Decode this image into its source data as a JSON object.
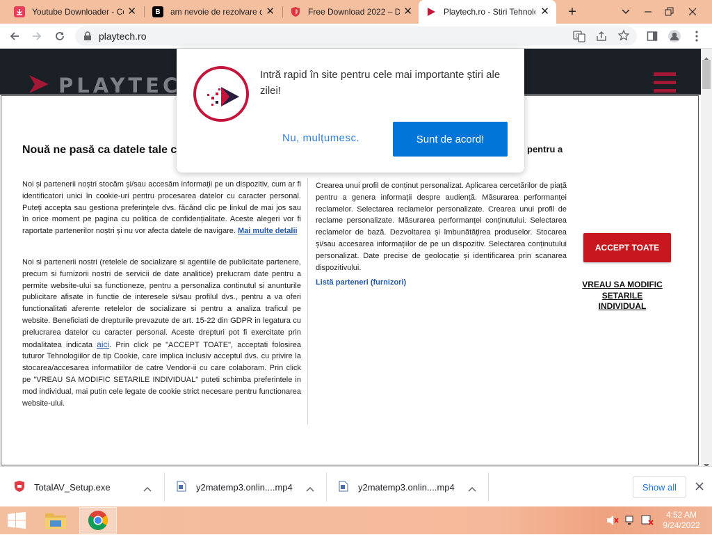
{
  "tabs": [
    {
      "label": "Youtube Downloader - Co",
      "icon": "download-icon",
      "color": "#e83e5c"
    },
    {
      "label": "am nevoie de rezolvare de",
      "icon": "brainly-icon",
      "color": "#000000"
    },
    {
      "label": "Free Download 2022 – D",
      "icon": "shield-icon",
      "color": "#e2323d"
    },
    {
      "label": "Playtech.ro - Stiri Tehnolo",
      "icon": "playtech-icon",
      "color": "#c4163a"
    }
  ],
  "address": {
    "url": "playtech.ro"
  },
  "site": {
    "logo": "PLAYTECH"
  },
  "consent": {
    "title": "Nouă ne pasă ca datele tale confidențiale",
    "right_heading": "pentru a",
    "para1": "Noi și partenerii noștri stocăm și/sau accesăm informații pe un dispozitiv, cum ar fi identificatori unici în cookie-uri pentru procesarea datelor cu caracter personal. Puteți accepta sau gestiona preferințele dvs. făcând clic pe linkul de mai jos sau în orice moment pe pagina cu politica de confidențialitate. Aceste alegeri vor fi raportate partenerilor noștri și nu vor afecta datele de navigare.",
    "more_details": "Mai multe detalii",
    "para2a": "Noi si partenerii nostri (retelele de socializare si agentiile de publicitate partenere, precum si furnizorii nostri de servicii de date analitice) prelucram date pentru a permite website-ului sa functioneze, pentru a personaliza continutul si anunturile publicitare afisate in functie de interesele si/sau profilul dvs., pentru a va oferi functionalitati aferente retelelor de socializare si pentru a analiza traficul pe website. Beneficiati de drepturile prevazute de art. 15-22 din GDPR in legatura cu prelucrarea datelor cu caracter personal. Aceste drepturi pot fi exercitate prin modalitatea indicata",
    "aici": "aici",
    "para2b": ". Prin click pe \"ACCEPT TOATE\", acceptati folosirea tuturor Tehnologiilor de tip Cookie, care implica inclusiv acceptul dvs. cu privire la stocarea/accesarea informatiilor de catre Vendor-ii cu care colaboram. Prin click pe \"VREAU SA MODIFIC SETARILE INDIVIDUAL\" puteti schimba preferintele in mod individual, mai putin cele legate de cookie strict necesare pentru functionarea website-ului.",
    "purposes": "Crearea unui profil de conținut personalizat. Aplicarea cercetărilor de piață pentru a genera informații despre audiență. Măsurarea performanței reclamelor. Selectarea reclamelor personalizate. Crearea unui profil de reclame personalizate. Măsurarea performanței conținutului. Selectarea reclamelor de bază. Dezvoltarea și îmbunătățirea produselor. Stocarea și/sau accesarea informațiilor de pe un dispozitiv. Selectarea conținutului personalizat. Date precise de geolocație și identificarea prin scanarea dispozitivului.",
    "partners_link": "Listă parteneri (furnizori)",
    "accept_all": "ACCEPT TOATE",
    "modify_settings": "VREAU SA MODIFIC SETARILE INDIVIDUAL",
    "accent": "#c8171e"
  },
  "notification": {
    "message": "Intră rapid în site pentru cele mai importante știri ale zilei!",
    "decline": "Nu, mulțumesc.",
    "accept": "Sunt de acord!",
    "accent": "#0275d8"
  },
  "downloads": {
    "items": [
      {
        "name": "TotalAV_Setup.exe",
        "icon": "totalav-icon"
      },
      {
        "name": "y2matemp3.onlin....mp4",
        "icon": "file-icon"
      },
      {
        "name": "y2matemp3.onlin....mp4",
        "icon": "file-icon"
      }
    ],
    "show_all": "Show all"
  },
  "taskbar": {
    "time": "4:52 AM",
    "date": "9/24/2022"
  }
}
